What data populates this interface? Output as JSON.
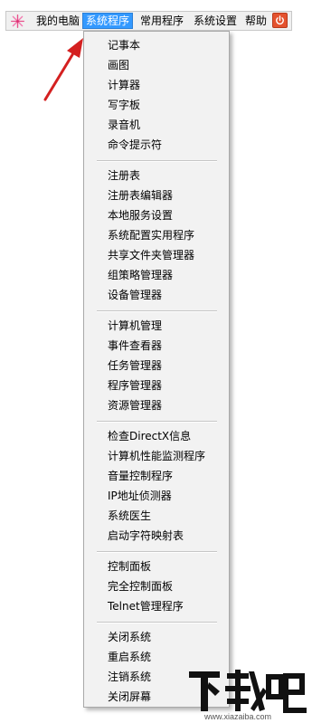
{
  "menubar": {
    "items": [
      {
        "label": "我的电脑"
      },
      {
        "label": "系统程序"
      },
      {
        "label": "常用程序"
      },
      {
        "label": "系统设置"
      },
      {
        "label": "帮助"
      }
    ],
    "active_index": 1,
    "logo_icon": "pinwheel-icon",
    "close_icon": "power-icon",
    "accent_color": "#3399ff",
    "close_color": "#e4522e"
  },
  "dropdown": {
    "groups": [
      [
        "记事本",
        "画图",
        "计算器",
        "写字板",
        "录音机",
        "命令提示符"
      ],
      [
        "注册表",
        "注册表编辑器",
        "本地服务设置",
        "系统配置实用程序",
        "共享文件夹管理器",
        "组策略管理器",
        "设备管理器"
      ],
      [
        "计算机管理",
        "事件查看器",
        "任务管理器",
        "程序管理器",
        "资源管理器"
      ],
      [
        "检查DirectX信息",
        "计算机性能监测程序",
        "音量控制程序",
        "IP地址侦测器",
        "系统医生",
        "启动字符映射表"
      ],
      [
        "控制面板",
        "完全控制面板",
        "Telnet管理程序"
      ],
      [
        "关闭系统",
        "重启系统",
        "注销系统",
        "关闭屏幕"
      ]
    ]
  },
  "annotation": {
    "arrow_icon": "red-arrow-icon",
    "arrow_color": "#d42020"
  },
  "watermark": {
    "logo_text": "下载吧",
    "url": "www.xiazaiba.com"
  }
}
